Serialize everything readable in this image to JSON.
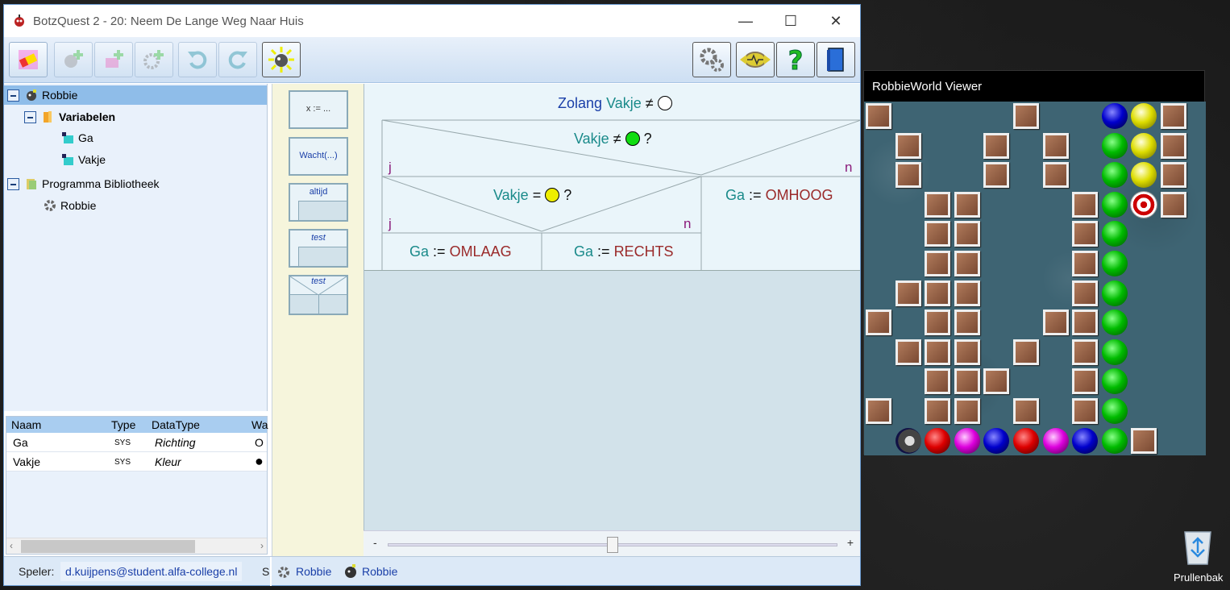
{
  "window": {
    "title": "BotzQuest 2 - 20: Neem De Lange Weg Naar Huis",
    "minimize": "—",
    "maximize": "☐",
    "close": "✕"
  },
  "toolbar": {
    "left_icons": [
      "eraser-icon",
      "add-robot-icon",
      "add-group-icon",
      "add-gear-icon",
      "undo-icon",
      "redo-icon",
      "run-icon"
    ],
    "right_icons": [
      "settings-icon",
      "connect-icon",
      "help-icon",
      "book-icon"
    ]
  },
  "tree": {
    "root": "Robbie",
    "variables_group": "Variabelen",
    "variables": [
      "Ga",
      "Vakje"
    ],
    "library": "Programma Bibliotheek",
    "library_item": "Robbie"
  },
  "vartable": {
    "columns": [
      "Naam",
      "Type",
      "DataType",
      "Wa"
    ],
    "rows": [
      {
        "naam": "Ga",
        "type": "SYS",
        "datatype": "Richting",
        "waarde": "O"
      },
      {
        "naam": "Vakje",
        "type": "SYS",
        "datatype": "Kleur",
        "waarde": "●"
      }
    ]
  },
  "palette": {
    "assign": "x := ...",
    "wait": "Wacht(...)",
    "loop": "altijd",
    "test1": "test",
    "test2": "test"
  },
  "program": {
    "while_kw": "Zolang",
    "while_var": "Vakje",
    "neq": "≠",
    "eq": "=",
    "q": "?",
    "yes": "j",
    "no": "n",
    "if1_var": "Vakje",
    "if2_var": "Vakje",
    "assign": ":=",
    "ga": "Ga",
    "omhoog": "OMHOOG",
    "omlaag": "OMLAAG",
    "rechts": "RECHTS"
  },
  "zoom": {
    "minus": "-",
    "plus": "+",
    "value_fraction": 0.5
  },
  "status": {
    "speler_label": "Speler:",
    "speler_value": "d.kuijpens@student.alfa-college.nl",
    "cut_text": "S",
    "link1": "Robbie",
    "link2": "Robbie"
  },
  "viewer": {
    "title": "RobbieWorld Viewer"
  },
  "desktop": {
    "recycle_label": "Prullenbak"
  },
  "colors": {
    "accent_blue": "#1a3fa8",
    "teal": "#1a8a8a",
    "constant_red": "#9a2a2a",
    "selected": "#8fbde9"
  }
}
